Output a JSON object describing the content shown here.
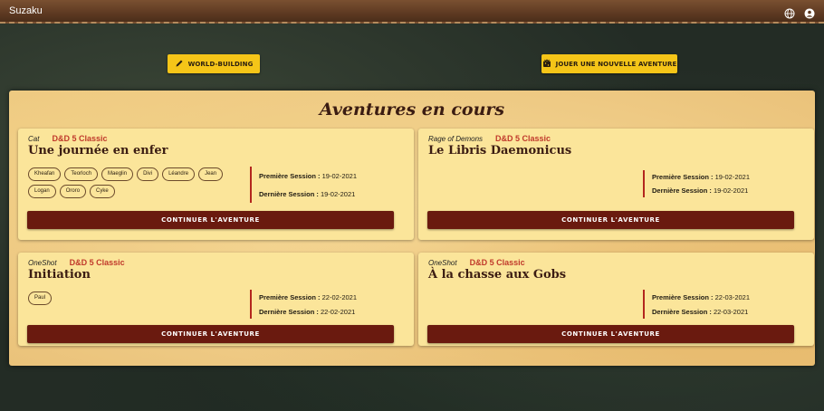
{
  "app": {
    "title": "Suzaku"
  },
  "toolbar": {
    "world_building_label": "WORLD-BUILDING",
    "new_adventure_label": "JOUER UNE NOUVELLE AVENTURE"
  },
  "section": {
    "title": "Aventures en cours"
  },
  "adventures": [
    {
      "type": "Cat",
      "system": "D&D 5 Classic",
      "title": "Une journée en enfer",
      "players": [
        "Kheafan",
        "Teorloch",
        "Maeglin",
        "Divi",
        "Léandre",
        "Jean",
        "Logan",
        "Ororo",
        "Cyke"
      ],
      "first_label": "Première Session :",
      "first_date": "19-02-2021",
      "last_label": "Dernière Session :",
      "last_date": "19-02-2021",
      "button": "CONTINUER L'AVENTURE"
    },
    {
      "type": "Rage of Demons",
      "system": "D&D 5 Classic",
      "title": "Le Libris Daemonicus",
      "players": [],
      "first_label": "Première Session :",
      "first_date": "19-02-2021",
      "last_label": "Dernière Session :",
      "last_date": "19-02-2021",
      "button": "CONTINUER L'AVENTURE"
    },
    {
      "type": "OneShot",
      "system": "D&D 5 Classic",
      "title": "Initiation",
      "players": [
        "Paul"
      ],
      "first_label": "Première Session :",
      "first_date": "22-02-2021",
      "last_label": "Dernière Session :",
      "last_date": "22-02-2021",
      "button": "CONTINUER L'AVENTURE"
    },
    {
      "type": "OneShot",
      "system": "D&D 5 Classic",
      "title": "À la chasse aux Gobs",
      "players": [],
      "first_label": "Première Session :",
      "first_date": "22-03-2021",
      "last_label": "Dernière Session :",
      "last_date": "22-03-2021",
      "button": "CONTINUER L'AVENTURE"
    }
  ],
  "colors": {
    "accent_yellow": "#f5c518",
    "button_dark_red": "#6a1a0f",
    "system_red": "#c0392b",
    "card_bg": "#fbe59a"
  },
  "icons": {
    "top_right": [
      "globe-icon",
      "account-icon"
    ],
    "world_building": "pencil-icon",
    "new_adventure": "dice-crown-icon"
  }
}
